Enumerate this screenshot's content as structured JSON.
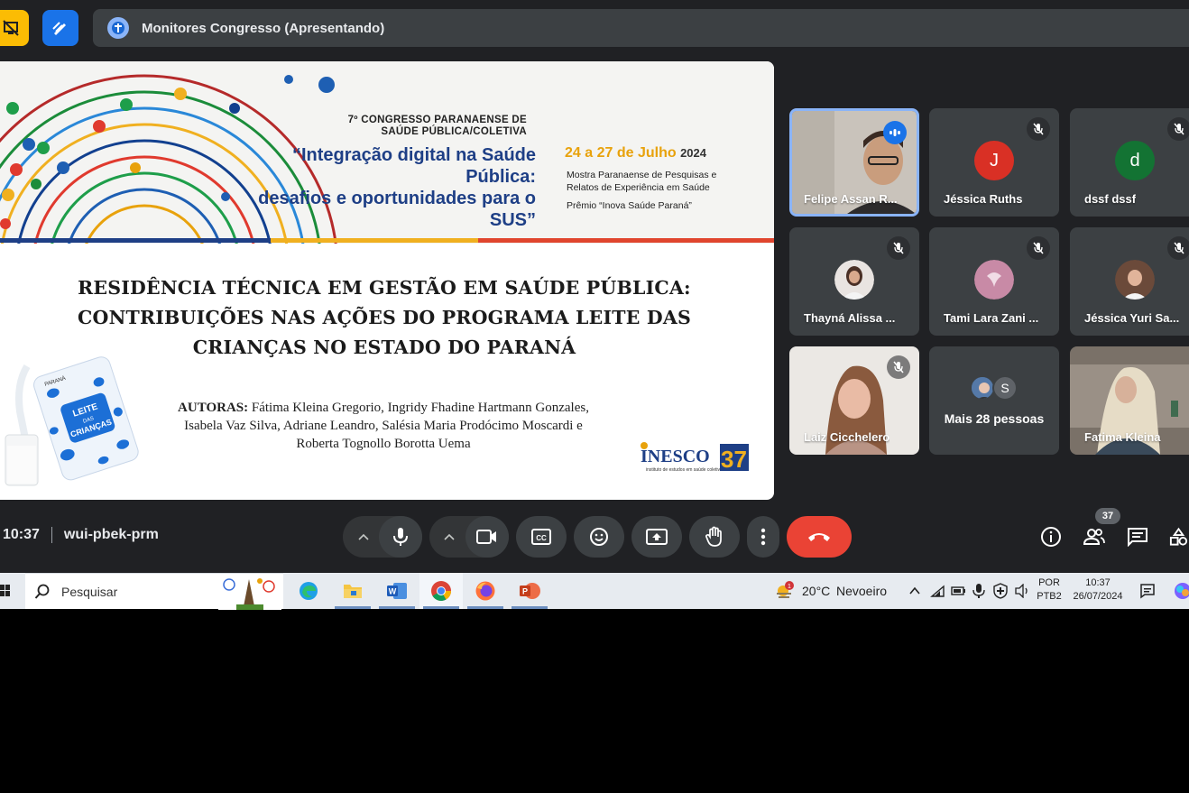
{
  "meet": {
    "presenting_title": "Monitores Congresso (Apresentando)",
    "time": "10:37",
    "meeting_code": "wui-pbek-prm",
    "participants_count": "37"
  },
  "slide": {
    "congress_line1": "7º CONGRESSO PARANAENSE DE",
    "congress_line2": "SAÚDE PÚBLICA/COLETIVA",
    "theme_line1": "“Integração digital na Saúde Pública:",
    "theme_line2": "desafios e oportunidades para o SUS”",
    "dates": "24 a 27 de Julho",
    "year": "2024",
    "side_line1": "Mostra Paranaense de Pesquisas e",
    "side_line2": "Relatos de Experiência em Saúde",
    "side_line3": "Prêmio “Inova Saúde Paraná”",
    "title_line1": "RESIDÊNCIA TÉCNICA EM GESTÃO EM SAÚDE PÚBLICA:",
    "title_line2": "CONTRIBUIÇÕES NAS AÇÕES DO PROGRAMA LEITE DAS",
    "title_line3": "CRIANÇAS NO ESTADO DO PARANÁ",
    "authors_label": "AUTORAS:",
    "authors_line1": "Fátima Kleina Gregorio, Ingridy Fhadine Hartmann Gonzales,",
    "authors_line2": "Isabela Vaz Silva, Adriane Leandro, Salésia Maria Prodócimo Moscardi e",
    "authors_line3": "Roberta Tognollo Borotta Uema",
    "milk_label1": "LEITE",
    "milk_label2": "DAS",
    "milk_label3": "CRIANÇAS",
    "milk_brand": "PARANÁ",
    "inesco_name": "INESCO",
    "inesco_sub": "instituto de estudos em saúde coletiva",
    "inesco_number": "37"
  },
  "participants": [
    {
      "name": "Felipe Assan R...",
      "type": "video",
      "speaking": true
    },
    {
      "name": "Jéssica Ruths",
      "type": "initial",
      "initial": "J",
      "color": "#d93025"
    },
    {
      "name": "dssf dssf",
      "type": "initial",
      "initial": "d",
      "color": "#137333"
    },
    {
      "name": "Thayná Alissa ...",
      "type": "photo"
    },
    {
      "name": "Tami Lara Zani ...",
      "type": "photo"
    },
    {
      "name": "Jéssica Yuri Sa...",
      "type": "photo"
    },
    {
      "name": "Laiz Cicchelero",
      "type": "video"
    },
    {
      "name": "Mais 28 pessoas",
      "type": "more",
      "initial": "S"
    },
    {
      "name": "Fatima Kleina",
      "type": "video"
    }
  ],
  "taskbar": {
    "search_label": "Pesquisar",
    "temperature": "20°C",
    "weather": "Nevoeiro",
    "weather_badge": "1",
    "lang_line1": "POR",
    "lang_line2": "PTB2",
    "time": "10:37",
    "date": "26/07/2024"
  },
  "colors": {
    "meet_bg": "#202124",
    "tile_bg": "#3c4043",
    "end_call": "#ea4335",
    "speaking_border": "#8ab4f8"
  }
}
